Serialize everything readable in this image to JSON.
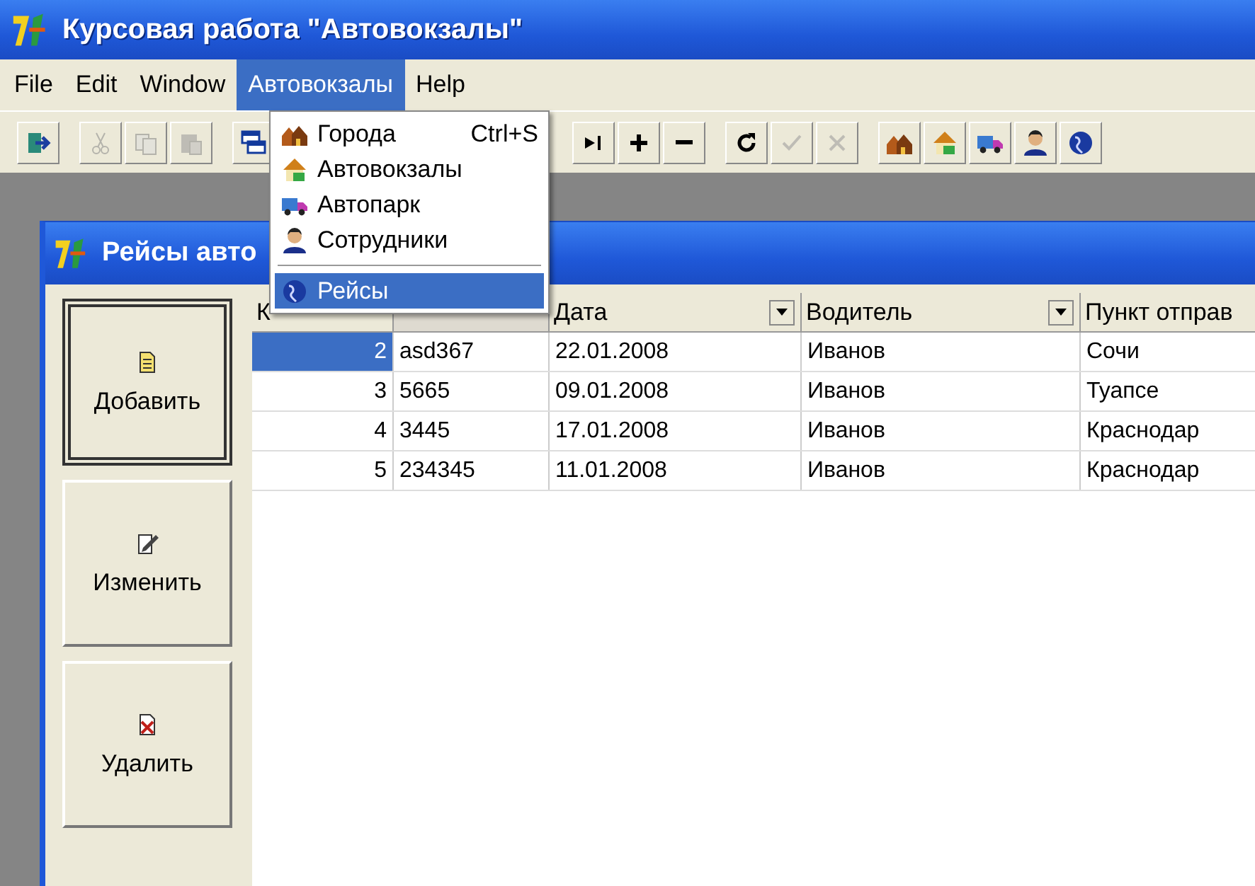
{
  "window": {
    "title": "Курсовая работа \"Автовокзалы\""
  },
  "menu_bar": [
    {
      "label": "File",
      "selected": false
    },
    {
      "label": "Edit",
      "selected": false
    },
    {
      "label": "Window",
      "selected": false
    },
    {
      "label": "Автовокзалы",
      "selected": true
    },
    {
      "label": "Help",
      "selected": false
    }
  ],
  "toolbar": [
    [
      {
        "kind": "exit",
        "disabled": false
      }
    ],
    [
      {
        "kind": "cut",
        "disabled": true
      },
      {
        "kind": "copy",
        "disabled": true
      },
      {
        "kind": "paste",
        "disabled": true
      }
    ],
    [
      {
        "kind": "windows",
        "disabled": false
      }
    ],
    [
      {
        "kind": "last",
        "disabled": false
      },
      {
        "kind": "plus",
        "disabled": false
      },
      {
        "kind": "minus",
        "disabled": false
      }
    ],
    [
      {
        "kind": "refresh",
        "disabled": false
      },
      {
        "kind": "confirm",
        "disabled": true
      },
      {
        "kind": "cancel",
        "disabled": true
      }
    ],
    [
      {
        "kind": "city",
        "disabled": false
      },
      {
        "kind": "station",
        "disabled": false
      },
      {
        "kind": "fleet",
        "disabled": false
      },
      {
        "kind": "staff",
        "disabled": false
      },
      {
        "kind": "trips",
        "disabled": false
      }
    ]
  ],
  "dropdown_menu": [
    {
      "kind": "item",
      "label": "Города",
      "shortcut": "Ctrl+S",
      "selected": false
    },
    {
      "kind": "item",
      "label": "Автовокзалы",
      "selected": false
    },
    {
      "kind": "item",
      "label": "Автопарк",
      "selected": false
    },
    {
      "kind": "item",
      "label": "Сотрудники",
      "selected": false
    },
    {
      "kind": "separator"
    },
    {
      "kind": "item",
      "label": "Рейсы",
      "selected": true
    }
  ],
  "child_window": {
    "title": "Рейсы авто",
    "buttons": [
      {
        "label": "Добавить",
        "focused": true
      },
      {
        "label": "Изменить",
        "focused": false
      },
      {
        "label": "Удалить",
        "focused": false
      }
    ],
    "table": {
      "columns": [
        {
          "label": "К"
        },
        {
          "kind": "covered"
        },
        {
          "label": "Дата",
          "dropdown": true
        },
        {
          "label": "Водитель",
          "dropdown": true
        },
        {
          "label": "Пункт отправ"
        }
      ],
      "rows": [
        {
          "selected": true,
          "cells": [
            "2",
            "asd367",
            "22.01.2008",
            "Иванов",
            "Сочи"
          ]
        },
        {
          "selected": false,
          "cells": [
            "3",
            "5665",
            "09.01.2008",
            "Иванов",
            "Туапсе"
          ]
        },
        {
          "selected": false,
          "cells": [
            "4",
            "3445",
            "17.01.2008",
            "Иванов",
            "Краснодар"
          ]
        },
        {
          "selected": false,
          "cells": [
            "5",
            "234345",
            "11.01.2008",
            "Иванов",
            "Краснодар"
          ]
        }
      ]
    }
  }
}
